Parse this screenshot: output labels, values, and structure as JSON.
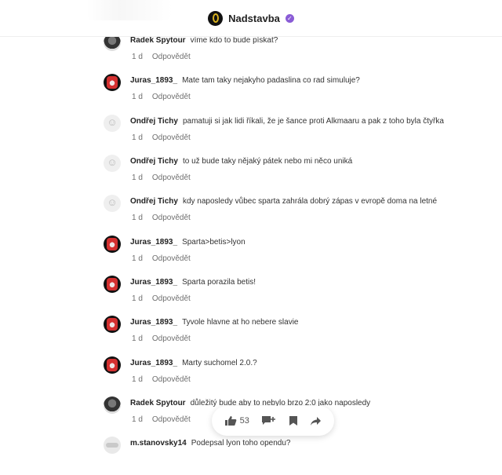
{
  "header": {
    "brand": "Nadstavba"
  },
  "comments": [
    {
      "author": "Radek Spytour",
      "avatar": "radek",
      "text": "víme kdo to bude pískat?",
      "age": "1 d",
      "reply": "Odpovědět"
    },
    {
      "author": "Juras_1893_",
      "avatar": "juras",
      "text": "Mate tam taky nejakyho padaslina co rad simuluje?",
      "age": "1 d",
      "reply": "Odpovědět"
    },
    {
      "author": "Ondřej Tichy",
      "avatar": "ondrej",
      "text": "pamatuji si jak lidi říkali, že je šance proti Alkmaaru a pak z toho byla čtyřka",
      "age": "1 d",
      "reply": "Odpovědět"
    },
    {
      "author": "Ondřej Tichy",
      "avatar": "ondrej",
      "text": "to už bude taky nějaký pátek nebo mi něco uniká",
      "age": "1 d",
      "reply": "Odpovědět"
    },
    {
      "author": "Ondřej Tichy",
      "avatar": "ondrej",
      "text": "kdy naposledy vůbec sparta zahrála dobrý zápas v evropě doma na letné",
      "age": "1 d",
      "reply": "Odpovědět"
    },
    {
      "author": "Juras_1893_",
      "avatar": "juras",
      "text": "Sparta>betis>lyon",
      "age": "1 d",
      "reply": "Odpovědět"
    },
    {
      "author": "Juras_1893_",
      "avatar": "juras",
      "text": "Sparta porazila betis!",
      "age": "1 d",
      "reply": "Odpovědět"
    },
    {
      "author": "Juras_1893_",
      "avatar": "juras",
      "text": "Tyvole hlavne at ho nebere slavie",
      "age": "1 d",
      "reply": "Odpovědět"
    },
    {
      "author": "Juras_1893_",
      "avatar": "juras",
      "text": "Marty suchomel 2.0.?",
      "age": "1 d",
      "reply": "Odpovědět"
    },
    {
      "author": "Radek Spytour",
      "avatar": "radek",
      "text": "důležitý bude aby to nebylo brzo 2:0 jako naposledy",
      "age": "1 d",
      "reply": "Odpovědět"
    },
    {
      "author": "m.stanovsky14",
      "avatar": "ms",
      "text": "Podepsal lyon toho opendu?",
      "age": "",
      "reply": ""
    }
  ],
  "actions": {
    "like_count": "53"
  }
}
